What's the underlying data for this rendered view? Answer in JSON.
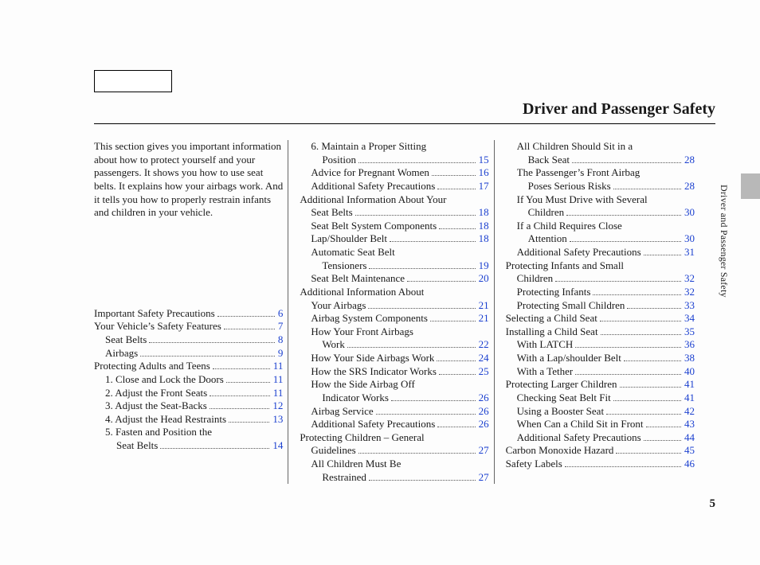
{
  "header": {
    "title": "Driver and Passenger Safety"
  },
  "side_label": "Driver and Passenger Safety",
  "page_number": "5",
  "intro_text": "This section gives you important information about how to protect yourself and your passengers. It shows you how to use seat belts. It explains how your airbags work. And it tells you how to properly restrain infants and children in your vehicle.",
  "columns": [
    [
      {
        "level": 1,
        "label": "Important Safety Precautions",
        "page": "6"
      },
      {
        "level": 1,
        "label": "Your Vehicle’s Safety Features",
        "page": "7"
      },
      {
        "level": 2,
        "label": "Seat Belts",
        "page": "8"
      },
      {
        "level": 2,
        "label": "Airbags",
        "page": "9"
      },
      {
        "level": 1,
        "label": "Protecting Adults and Teens",
        "page": "11"
      },
      {
        "level": 2,
        "label": "1. Close and Lock the Doors",
        "page": "11"
      },
      {
        "level": 2,
        "label": "2. Adjust the Front Seats",
        "page": "11"
      },
      {
        "level": 2,
        "label": "3. Adjust the Seat-Backs",
        "page": "12"
      },
      {
        "level": 2,
        "label": "4. Adjust the Head Restraints",
        "page": "13"
      },
      {
        "level": 2,
        "label": "5. Fasten and Position the",
        "cont": "Seat Belts",
        "page": "14"
      }
    ],
    [
      {
        "level": 2,
        "label": "6. Maintain a Proper Sitting",
        "cont": "Position",
        "page": "15"
      },
      {
        "level": 2,
        "label": "Advice for Pregnant Women",
        "page": "16"
      },
      {
        "level": 2,
        "label": "Additional Safety Precautions",
        "page": "17"
      },
      {
        "level": 1,
        "label": "Additional Information About Your",
        "cont": "Seat Belts",
        "page": "18"
      },
      {
        "level": 2,
        "label": "Seat Belt System Components",
        "page": "18"
      },
      {
        "level": 2,
        "label": "Lap/Shoulder Belt",
        "page": "18"
      },
      {
        "level": 2,
        "label": "Automatic Seat Belt",
        "cont": "Tensioners",
        "page": "19"
      },
      {
        "level": 2,
        "label": "Seat Belt Maintenance",
        "page": "20"
      },
      {
        "level": 1,
        "label": "Additional Information About",
        "cont": "Your Airbags",
        "page": "21"
      },
      {
        "level": 2,
        "label": "Airbag System Components",
        "page": "21"
      },
      {
        "level": 2,
        "label": "How Your Front Airbags",
        "cont": "Work",
        "page": "22"
      },
      {
        "level": 2,
        "label": "How Your Side Airbags Work",
        "page": "24"
      },
      {
        "level": 2,
        "label": "How the SRS Indicator Works",
        "page": "25"
      },
      {
        "level": 2,
        "label": "How the Side Airbag Off",
        "cont": "Indicator Works",
        "page": "26"
      },
      {
        "level": 2,
        "label": "Airbag Service",
        "page": "26"
      },
      {
        "level": 2,
        "label": "Additional Safety Precautions",
        "page": "26"
      },
      {
        "level": 1,
        "label": "Protecting Children – General",
        "cont": "Guidelines",
        "page": "27"
      },
      {
        "level": 2,
        "label": "All Children Must Be",
        "cont": "Restrained",
        "page": "27"
      }
    ],
    [
      {
        "level": 2,
        "label": "All Children Should Sit in a",
        "cont": "Back Seat",
        "page": "28"
      },
      {
        "level": 2,
        "label": "The Passenger’s Front Airbag",
        "cont": "Poses Serious Risks",
        "page": "28"
      },
      {
        "level": 2,
        "label": "If You Must Drive with Several",
        "cont": "Children",
        "page": "30"
      },
      {
        "level": 2,
        "label": "If a Child Requires Close",
        "cont": "Attention",
        "page": "30"
      },
      {
        "level": 2,
        "label": "Additional Safety Precautions",
        "page": "31"
      },
      {
        "level": 1,
        "label": "Protecting Infants and Small",
        "cont": "Children",
        "page": "32"
      },
      {
        "level": 2,
        "label": "Protecting Infants",
        "page": "32"
      },
      {
        "level": 2,
        "label": "Protecting Small Children",
        "page": "33"
      },
      {
        "level": 1,
        "label": "Selecting a Child Seat",
        "page": "34"
      },
      {
        "level": 1,
        "label": "Installing a Child Seat",
        "page": "35"
      },
      {
        "level": 2,
        "label": "With LATCH",
        "page": "36"
      },
      {
        "level": 2,
        "label": "With a Lap/shoulder Belt",
        "page": "38"
      },
      {
        "level": 2,
        "label": "With a Tether",
        "page": "40"
      },
      {
        "level": 1,
        "label": "Protecting Larger Children",
        "page": "41"
      },
      {
        "level": 2,
        "label": "Checking Seat Belt Fit",
        "page": "41"
      },
      {
        "level": 2,
        "label": "Using a Booster Seat",
        "page": "42"
      },
      {
        "level": 2,
        "label": "When Can a Child Sit in Front",
        "page": "43"
      },
      {
        "level": 2,
        "label": "Additional Safety Precautions",
        "page": "44"
      },
      {
        "level": 1,
        "label": "Carbon Monoxide Hazard",
        "page": "45"
      },
      {
        "level": 1,
        "label": "Safety Labels",
        "page": "46"
      }
    ]
  ]
}
